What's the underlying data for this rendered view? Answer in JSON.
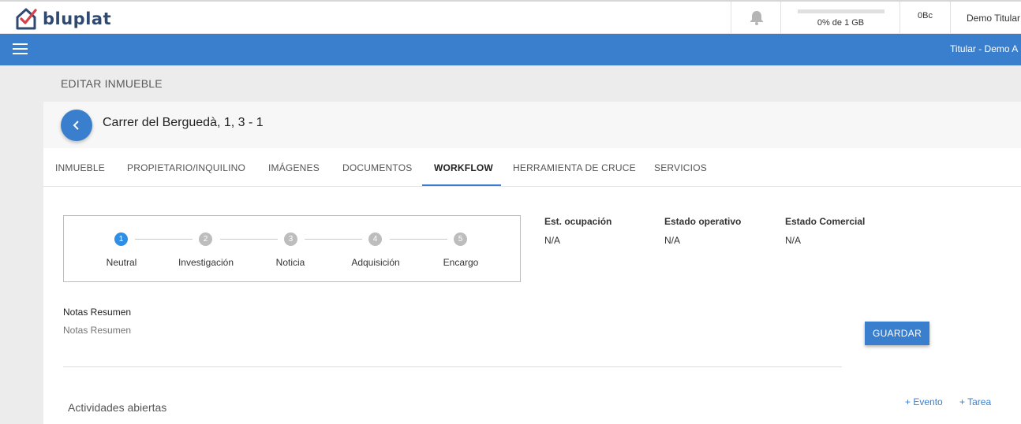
{
  "header": {
    "logo_text": "bluplat",
    "storage": {
      "text": "0% de 1 GB",
      "fraction": 0.0
    },
    "credits": "0Bc",
    "user": "Demo Titular"
  },
  "nav": {
    "user": "Titular - Demo A"
  },
  "page": {
    "title": "EDITAR INMUEBLE"
  },
  "property": {
    "title": "Carrer del Berguedà, 1, 3 - 1"
  },
  "tabs": [
    {
      "label": "INMUEBLE"
    },
    {
      "label": "PROPIETARIO/INQUILINO"
    },
    {
      "label": "IMÁGENES"
    },
    {
      "label": "DOCUMENTOS"
    },
    {
      "label": "WORKFLOW",
      "active": true
    },
    {
      "label": "HERRAMIENTA DE CRUCE"
    },
    {
      "label": "SERVICIOS"
    }
  ],
  "workflow": {
    "steps": [
      {
        "num": "1",
        "label": "Neutral",
        "active": true
      },
      {
        "num": "2",
        "label": "Investigación"
      },
      {
        "num": "3",
        "label": "Noticia"
      },
      {
        "num": "4",
        "label": "Adquisición"
      },
      {
        "num": "5",
        "label": "Encargo"
      }
    ],
    "status": [
      {
        "label": "Est. ocupación",
        "value": "N/A"
      },
      {
        "label": "Estado operativo",
        "value": "N/A"
      },
      {
        "label": "Estado Comercial",
        "value": "N/A"
      }
    ]
  },
  "notes": {
    "label": "Notas Resumen",
    "placeholder": "Notas Resumen",
    "value": ""
  },
  "save_label": "GUARDAR",
  "activities": {
    "title": "Actividades abiertas",
    "add_event": "+ Evento",
    "add_task": "+ Tarea"
  },
  "colors": {
    "primary": "#3a7fcd",
    "step_active": "#2f8ee5",
    "step_inactive": "#bdbdbd"
  }
}
